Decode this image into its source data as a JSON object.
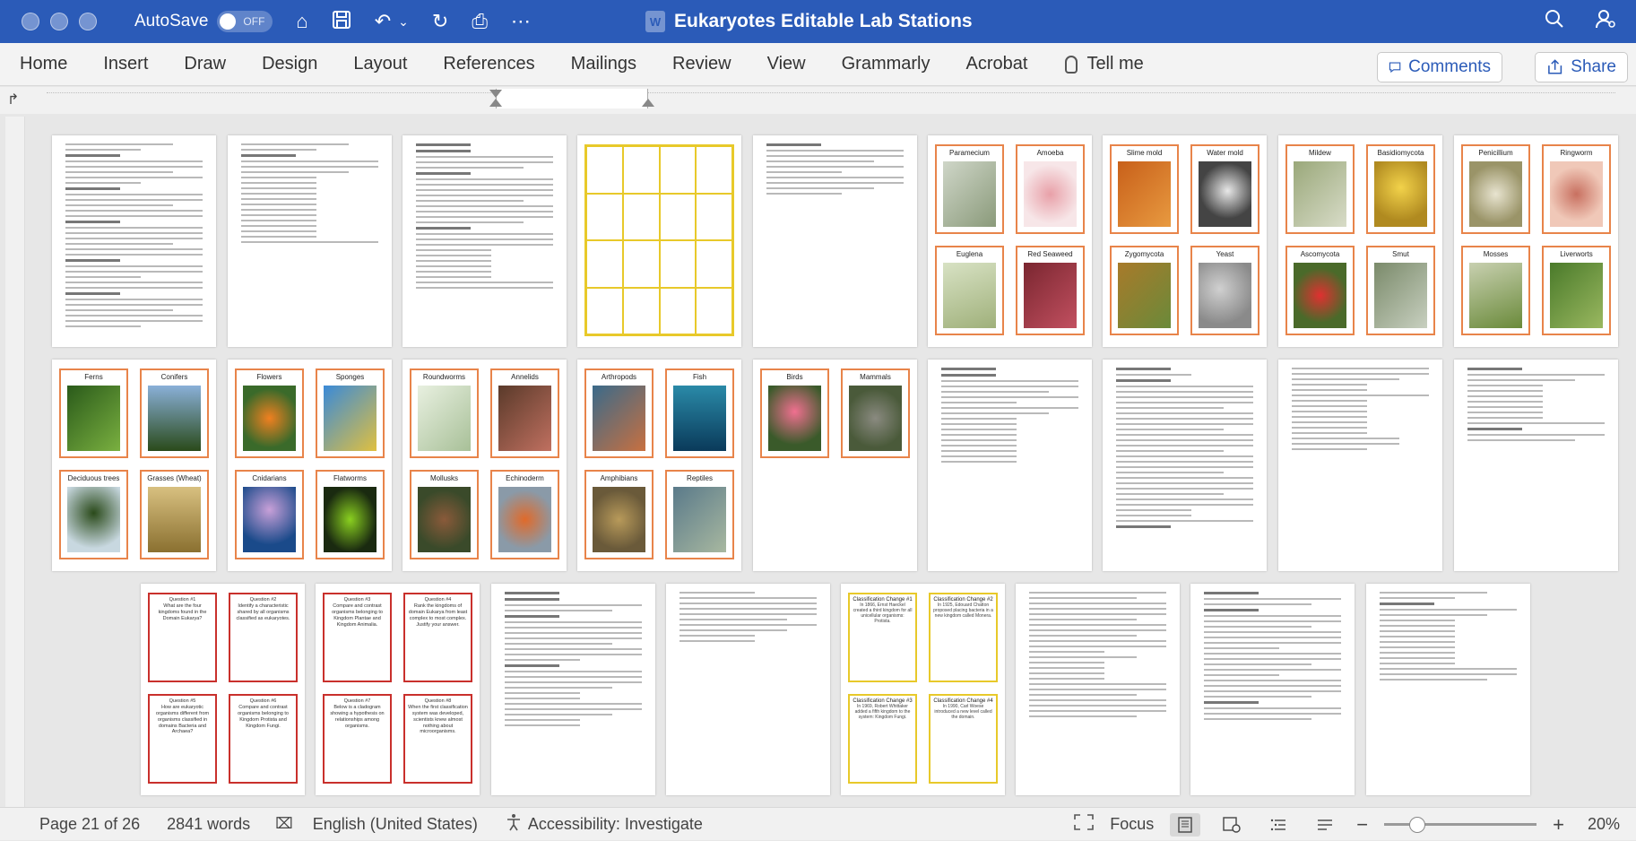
{
  "window": {
    "autosave_label": "AutoSave",
    "autosave_state": "OFF",
    "doc_title": "Eukaryotes Editable Lab Stations",
    "word_badge": "W"
  },
  "ribbon": {
    "tabs": [
      "Home",
      "Insert",
      "Draw",
      "Design",
      "Layout",
      "References",
      "Mailings",
      "Review",
      "View",
      "Grammarly",
      "Acrobat"
    ],
    "tell_me": "Tell me",
    "comments": "Comments",
    "share": "Share"
  },
  "status": {
    "page": "Page 21 of 26",
    "words": "2841 words",
    "language": "English (United States)",
    "accessibility": "Accessibility: Investigate",
    "focus": "Focus",
    "zoom": "20%",
    "zoom_minus": "−",
    "zoom_plus": "+"
  },
  "cards": {
    "row1_page6": [
      "Paramecium",
      "Amoeba",
      "Euglena",
      "Red Seaweed"
    ],
    "row1_page7": [
      "Slime mold",
      "Water mold",
      "Zygomycota",
      "Yeast"
    ],
    "row1_page8": [
      "Mildew",
      "Basidiomycota",
      "Ascomycota",
      "Smut"
    ],
    "row1_page9": [
      "Penicillium",
      "Ringworm",
      "Mosses",
      "Liverworts"
    ],
    "row2_page1": [
      "Ferns",
      "Conifers",
      "Deciduous trees",
      "Grasses (Wheat)"
    ],
    "row2_page2": [
      "Flowers",
      "Sponges",
      "Cnidarians",
      "Flatworms"
    ],
    "row2_page3": [
      "Roundworms",
      "Annelids",
      "Mollusks",
      "Echinoderm"
    ],
    "row2_page4": [
      "Arthropods",
      "Fish",
      "Amphibians",
      "Reptiles"
    ],
    "row2_page5": [
      "Birds",
      "Mammals"
    ]
  },
  "questions": [
    {
      "title": "Question #1",
      "text": "What are the four kingdoms found in the Domain Eukarya?"
    },
    {
      "title": "Question #2",
      "text": "Identify a characteristic shared by all organisms classified as eukaryotes."
    },
    {
      "title": "Question #3",
      "text": "Compare and contrast organisms belonging to Kingdom Plantae and Kingdom Animalia."
    },
    {
      "title": "Question #4",
      "text": "Rank the kingdoms of domain Eukarya from least complex to most complex. Justify your answer."
    },
    {
      "title": "Question #5",
      "text": "How are eukaryotic organisms different from organisms classified in domains Bacteria and Archaea?"
    },
    {
      "title": "Question #6",
      "text": "Compare and contrast organisms belonging to Kingdom Protista and Kingdom Fungi."
    },
    {
      "title": "Question #7",
      "text": "Below is a cladogram showing a hypothesis on relationships among organisms."
    },
    {
      "title": "Question #8",
      "text": "When the first classification system was developed, scientists knew almost nothing about microorganisms."
    }
  ],
  "classification_cards": [
    {
      "title": "Classification Change #1",
      "text": "In 1866, Ernst Haeckel created a third kingdom for all unicellular organisms: Protista."
    },
    {
      "title": "Classification Change #2",
      "text": "In 1925, Edouard Chatton proposed placing bacteria in a new kingdom called Monera."
    },
    {
      "title": "Classification Change #3",
      "text": "In 1969, Robert Whittaker added a fifth kingdom to the system: Kingdom Fungi."
    },
    {
      "title": "Classification Change #4",
      "text": "In 1990, Carl Woese introduced a new level called the domain."
    }
  ]
}
